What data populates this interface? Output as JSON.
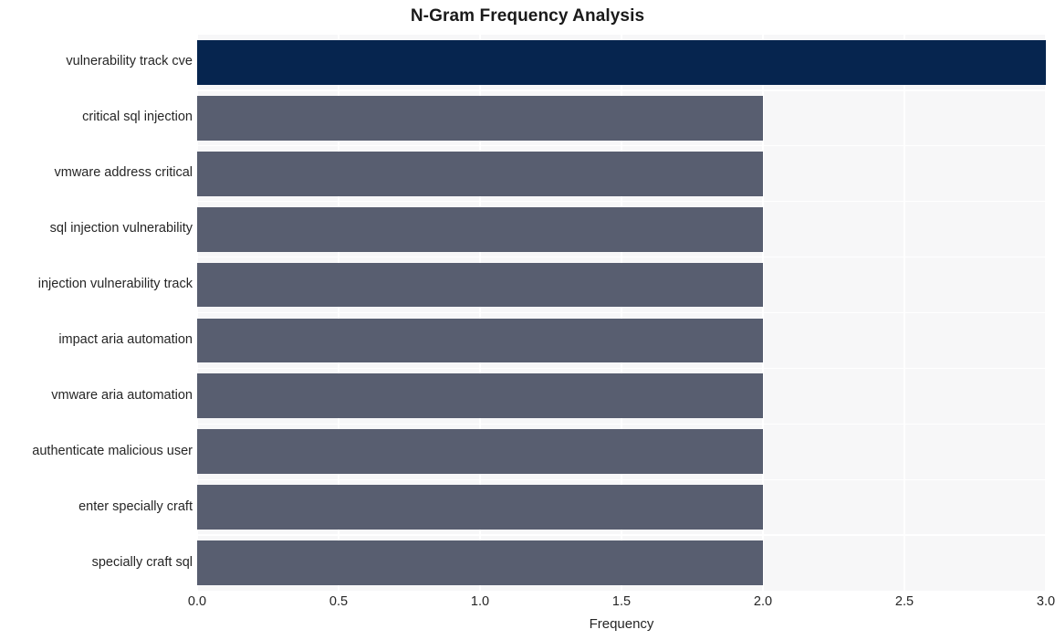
{
  "chart_data": {
    "type": "bar",
    "orientation": "horizontal",
    "title": "N-Gram Frequency Analysis",
    "xlabel": "Frequency",
    "ylabel": "",
    "categories": [
      "vulnerability track cve",
      "critical sql injection",
      "vmware address critical",
      "sql injection vulnerability",
      "injection vulnerability track",
      "impact aria automation",
      "vmware aria automation",
      "authenticate malicious user",
      "enter specially craft",
      "specially craft sql"
    ],
    "values": [
      3,
      2,
      2,
      2,
      2,
      2,
      2,
      2,
      2,
      2
    ],
    "xlim": [
      0.0,
      3.0
    ],
    "xticks": [
      0.0,
      0.5,
      1.0,
      1.5,
      2.0,
      2.5,
      3.0
    ],
    "xticklabels": [
      "0.0",
      "0.5",
      "1.0",
      "1.5",
      "2.0",
      "2.5",
      "3.0"
    ],
    "grid": true,
    "legend": null,
    "bar_colors": [
      "#06254f",
      "#585e70",
      "#585e70",
      "#585e70",
      "#585e70",
      "#585e70",
      "#585e70",
      "#585e70",
      "#585e70",
      "#585e70"
    ],
    "highlight_color": "#06254f",
    "default_color": "#585e70",
    "plot_background": "#f7f7f8",
    "figure_background": "#ffffff",
    "gridline_color": "#ffffff"
  }
}
